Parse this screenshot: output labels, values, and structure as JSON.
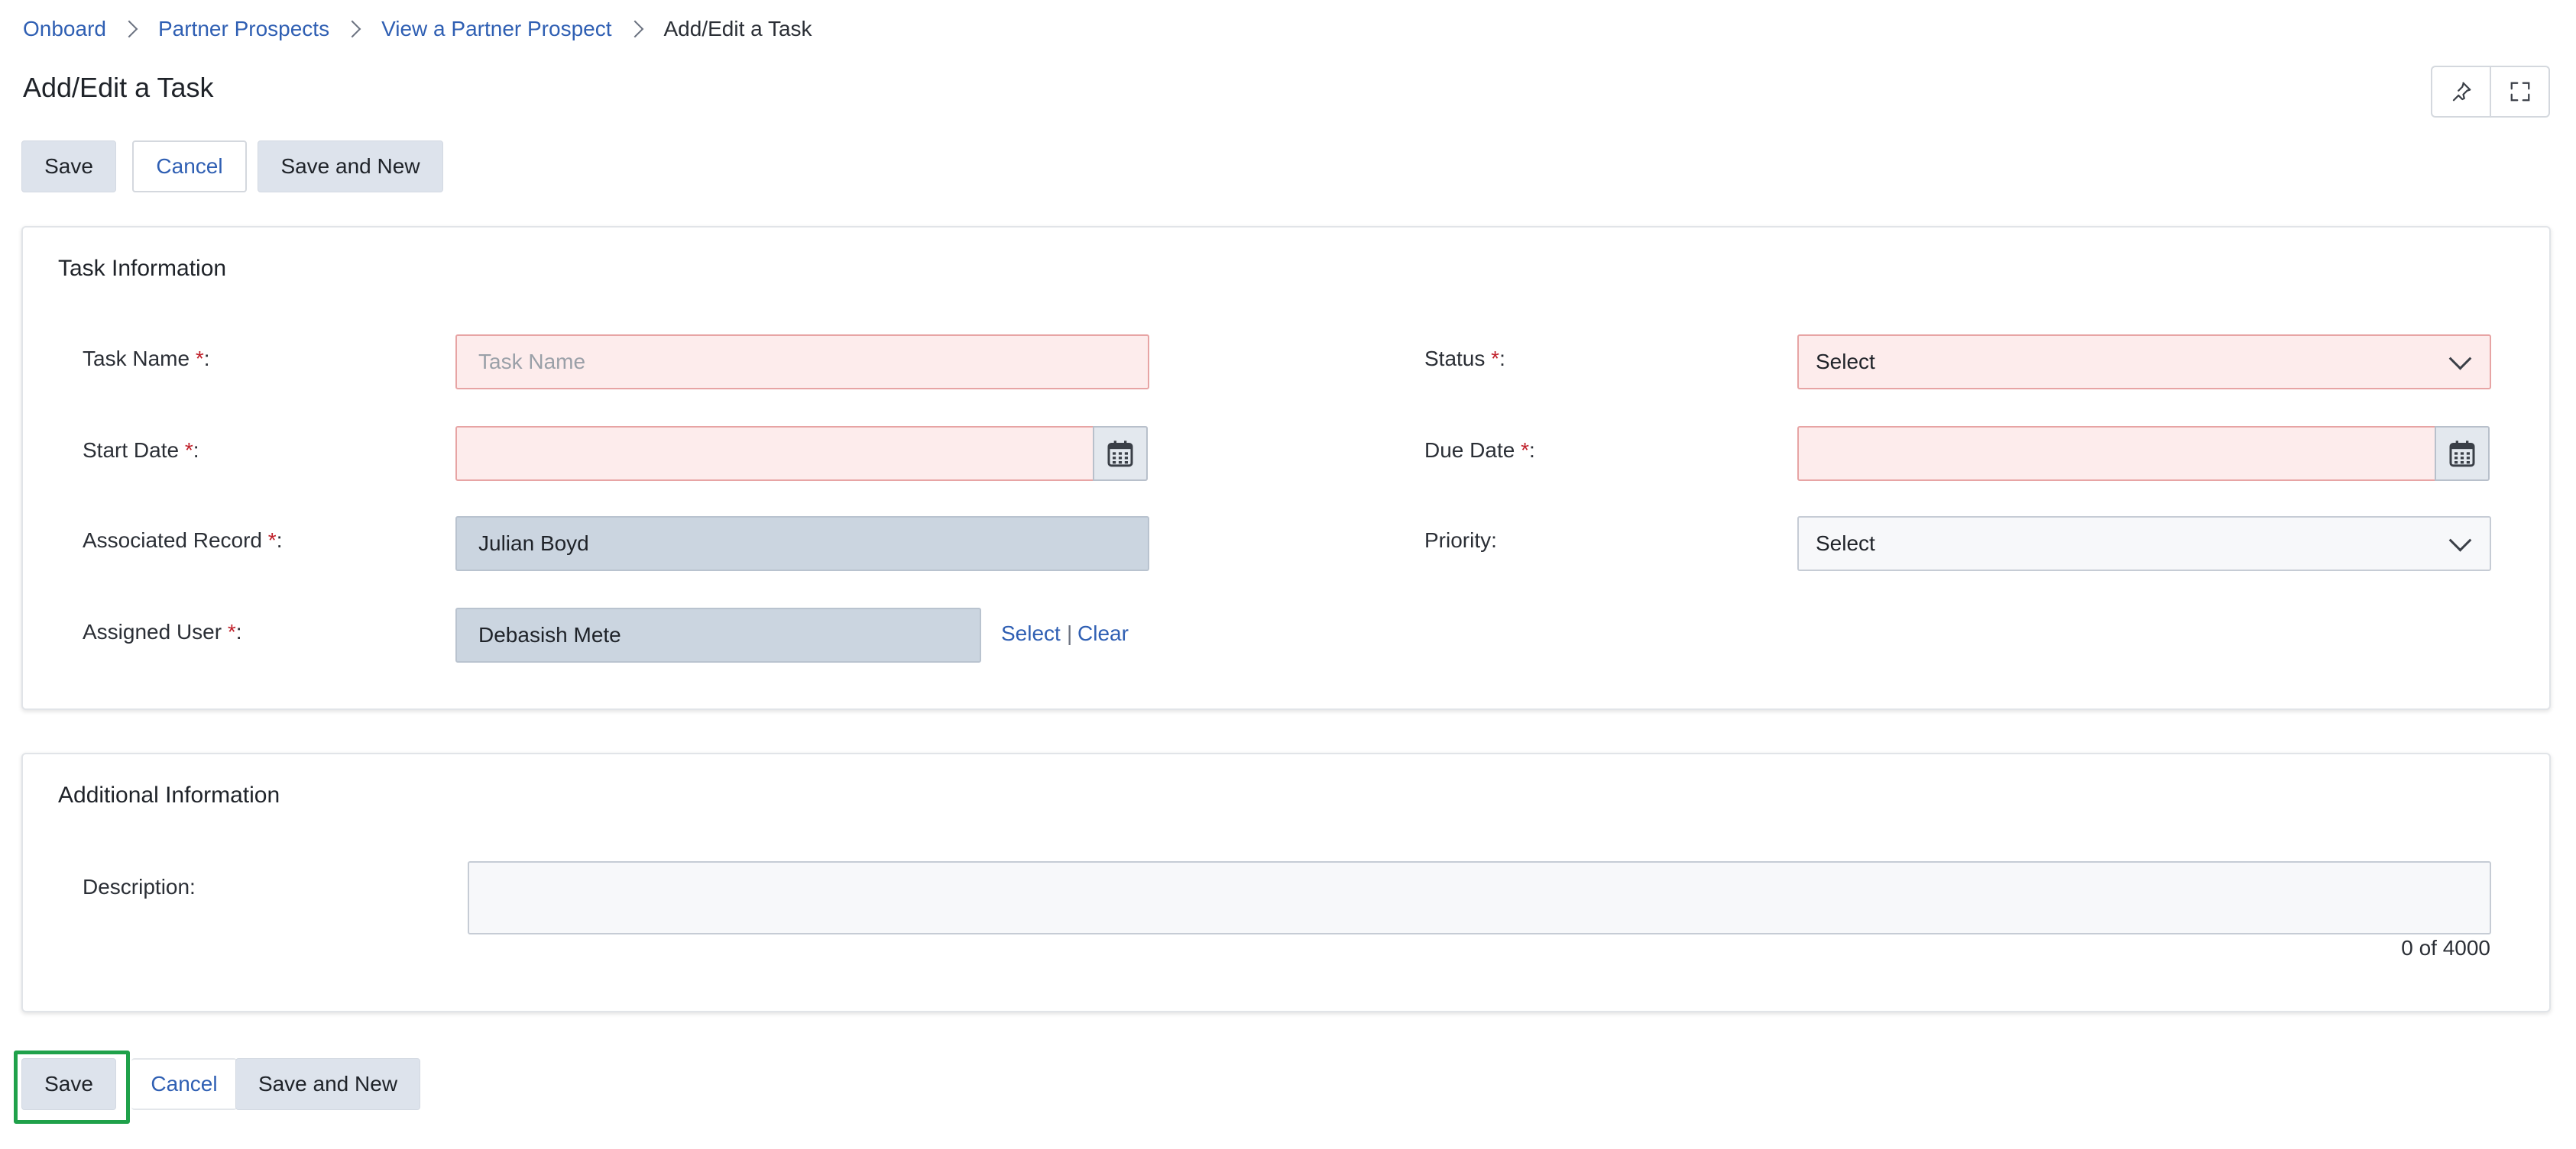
{
  "breadcrumb": {
    "items": [
      "Onboard",
      "Partner Prospects",
      "View a Partner Prospect"
    ],
    "current": "Add/Edit a Task"
  },
  "page": {
    "title": "Add/Edit a Task"
  },
  "toolbar": {
    "save_label": "Save",
    "cancel_label": "Cancel",
    "save_new_label": "Save and New"
  },
  "task_info": {
    "title": "Task Information",
    "task_name": {
      "label": "Task Name",
      "required_mark": "*",
      "suffix": ":",
      "value": "",
      "placeholder": "Task Name"
    },
    "status": {
      "label": "Status",
      "required_mark": "*",
      "suffix": ":",
      "value": "Select"
    },
    "start_date": {
      "label": "Start Date",
      "required_mark": "*",
      "suffix": ":",
      "value": ""
    },
    "due_date": {
      "label": "Due Date",
      "required_mark": "*",
      "suffix": ":",
      "value": ""
    },
    "associated_record": {
      "label": "Associated Record ",
      "required_mark": "*",
      "suffix": ":",
      "value": "Julian Boyd"
    },
    "priority": {
      "label": "Priority:",
      "value": "Select"
    },
    "assigned_user": {
      "label": "Assigned User",
      "required_mark": "*",
      "suffix": ":",
      "value": "Debasish Mete",
      "select_link": "Select",
      "separator": "|",
      "clear_link": "Clear"
    }
  },
  "additional_info": {
    "title": "Additional Information",
    "description": {
      "label": "Description:",
      "value": "",
      "char_count": "0 of 4000"
    }
  },
  "footer": {
    "save_label": "Save",
    "cancel_label": "Cancel",
    "save_new_label": "Save and New"
  },
  "colors": {
    "link": "#2f5fb3",
    "required": "#c0202a",
    "error_bg": "#fdecec",
    "highlight": "#1fa14a"
  }
}
